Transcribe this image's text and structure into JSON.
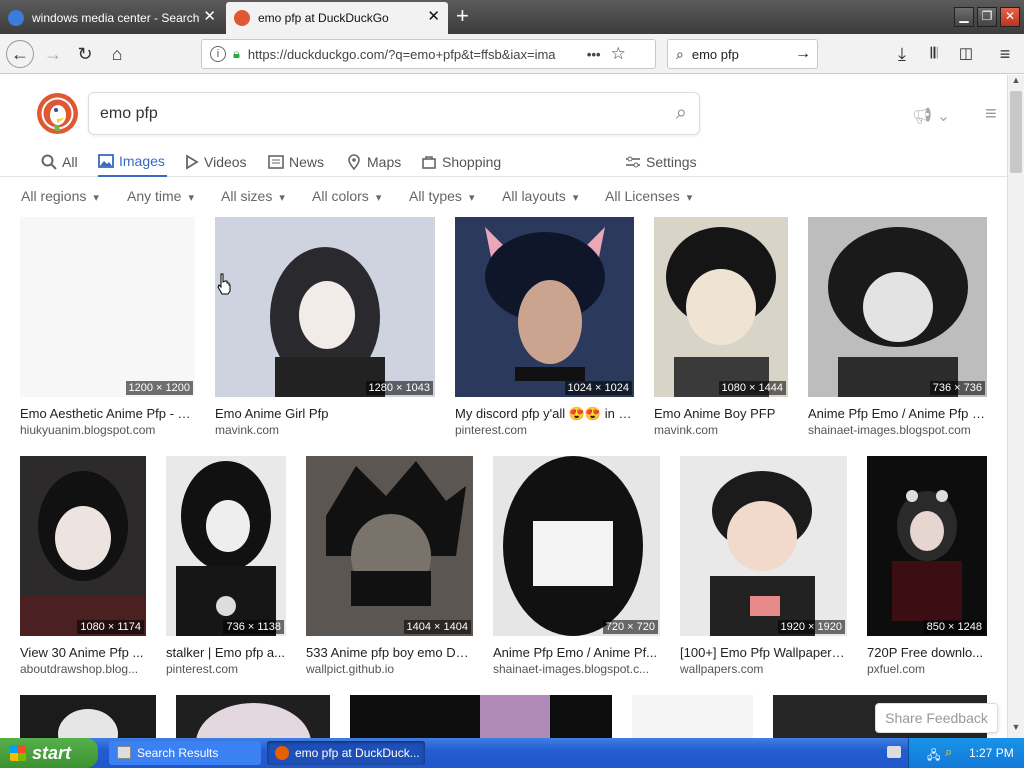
{
  "browser": {
    "tabs": [
      {
        "title": "windows media center - Search"
      },
      {
        "title": "emo pfp at DuckDuckGo"
      }
    ],
    "url": "https://duckduckgo.com/?q=emo+pfp&t=ffsb&iax=ima",
    "search_value": "emo pfp"
  },
  "search": {
    "query": "emo pfp"
  },
  "nav_tabs": [
    "All",
    "Images",
    "Videos",
    "News",
    "Maps",
    "Shopping"
  ],
  "settings_label": "Settings",
  "filters": [
    "All regions",
    "Any time",
    "All sizes",
    "All colors",
    "All types",
    "All layouts",
    "All Licenses"
  ],
  "results": [
    {
      "dims": "1200 × 1200",
      "title": "Emo Aesthetic Anime Pfp - a...",
      "source": "hiukyuanim.blogspot.com",
      "color": "#f7f7f7"
    },
    {
      "dims": "1280 × 1043",
      "title": "Emo Anime Girl Pfp",
      "source": "mavink.com",
      "color": "#cfd3df"
    },
    {
      "dims": "1024 × 1024",
      "title": "My discord pfp y'all 😍😍 in 2...",
      "source": "pinterest.com",
      "color": "#2b3a5c"
    },
    {
      "dims": "1080 × 1444",
      "title": "Emo Anime Boy PFP",
      "source": "mavink.com",
      "color": "#d9d4c8"
    },
    {
      "dims": "736 × 736",
      "title": "Anime Pfp Emo / Anime Pfp B...",
      "source": "shainaet-images.blogspot.com",
      "color": "#9a9a9a"
    },
    {
      "dims": "1080 × 1174",
      "title": "View 30 Anime Pfp ...",
      "source": "aboutdrawshop.blog...",
      "color": "#2d2a2b"
    },
    {
      "dims": "736 × 1138",
      "title": "stalker | Emo pfp a...",
      "source": "pinterest.com",
      "color": "#1d1d1d"
    },
    {
      "dims": "1404 × 1404",
      "title": "533 Anime pfp boy emo De...",
      "source": "wallpict.github.io",
      "color": "#5b5651"
    },
    {
      "dims": "720 × 720",
      "title": "Anime Pfp Emo / Anime Pf...",
      "source": "shainaet-images.blogspot.c...",
      "color": "#e6e6e6"
    },
    {
      "dims": "1920 × 1920",
      "title": "[100+] Emo Pfp Wallpapers ...",
      "source": "wallpapers.com",
      "color": "#c9c9c9"
    },
    {
      "dims": "850 × 1248",
      "title": "720P Free downlo...",
      "source": "pxfuel.com",
      "color": "#0d0d0d"
    }
  ],
  "feedback_label": "Share Feedback",
  "taskbar": {
    "start": "start",
    "tasks": [
      "Search Results",
      "emo pfp at DuckDuck..."
    ],
    "clock": "1:27 PM"
  }
}
